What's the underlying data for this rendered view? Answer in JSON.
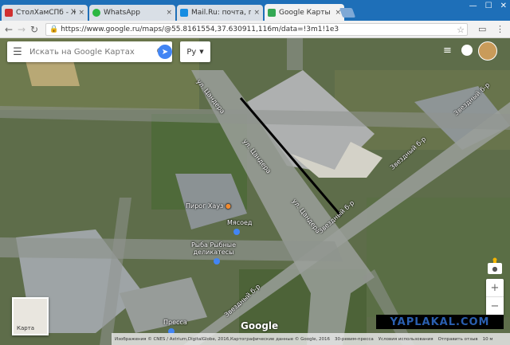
{
  "browser": {
    "tabs": [
      {
        "title": "СтолХамСПб - Жилая з",
        "color": "#d03030"
      },
      {
        "title": "WhatsApp",
        "color": "#2bb741"
      },
      {
        "title": "Mail.Ru: почта, поиск в",
        "color": "#168de2"
      },
      {
        "title": "Google Карты",
        "color": "#34a853"
      }
    ],
    "tab_close": "×",
    "url": "https://www.google.ru/maps/@55.8161554,37.630911,116m/data=!3m1!1e3"
  },
  "search": {
    "placeholder": "Искать на Google Картах"
  },
  "language": {
    "label": "Ру"
  },
  "map_labels": {
    "street_tsander_1": "ул. Цандера",
    "street_tsander_2": "ул. Цандера",
    "street_tsander_3": "ул. Цандера",
    "street_zvezdny_1": "Звездный б-р",
    "street_zvezdny_2": "Звездный б-р",
    "street_zvezdny_3": "Звездный б-р",
    "street_zvezdny_4": "Звездный б-р",
    "poi_pirog": "Пирог Хауз",
    "poi_myasoed": "Мясоед",
    "poi_ryba": "Рыба Рыбные деликатесы",
    "poi_pressa": "Пресса"
  },
  "layer": {
    "label": "Карта"
  },
  "google_logo": "Google",
  "footer": {
    "imagery": "Изображения © CNES / Astrium,DigitalGlobe, 2016,Картографические данные © Google, 2016",
    "russia": "30-ревим-пресса",
    "terms": "Условия использования",
    "feedback": "Отправить отзыв",
    "scale": "10 м"
  },
  "watermark": "YAPLAKAL.COM",
  "colors": {
    "accent": "#4285f4",
    "chrome": "#1e6fb8"
  }
}
